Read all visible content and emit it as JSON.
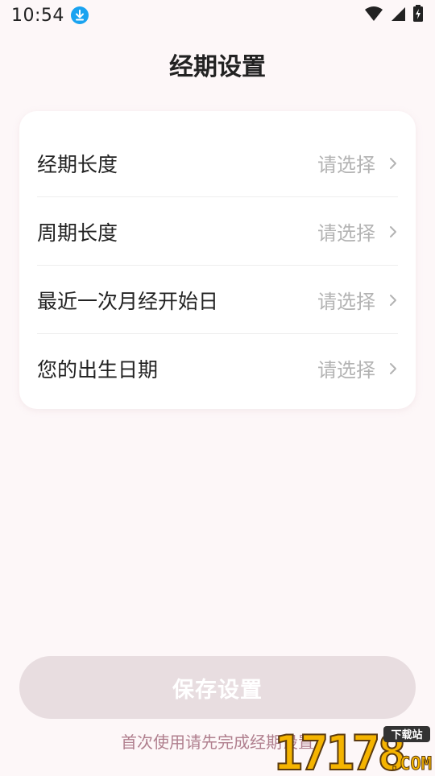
{
  "status_bar": {
    "time": "10:54"
  },
  "header": {
    "title": "经期设置"
  },
  "settings": {
    "items": [
      {
        "label": "经期长度",
        "value": "请选择"
      },
      {
        "label": "周期长度",
        "value": "请选择"
      },
      {
        "label": "最近一次月经开始日",
        "value": "请选择"
      },
      {
        "label": "您的出生日期",
        "value": "请选择"
      }
    ]
  },
  "footer": {
    "save_label": "保存设置",
    "hint": "首次使用请先完成经期设置"
  },
  "watermark": {
    "number": "17178",
    "badge": "下载站",
    "domain": ".COM"
  },
  "colors": {
    "background": "#fdf7f8",
    "save_button": "#e8dde0",
    "hint_text": "#b07f8e",
    "placeholder": "#b3b3b3",
    "download_badge": "#1aa3f0",
    "watermark_orange": "#f5b400"
  }
}
